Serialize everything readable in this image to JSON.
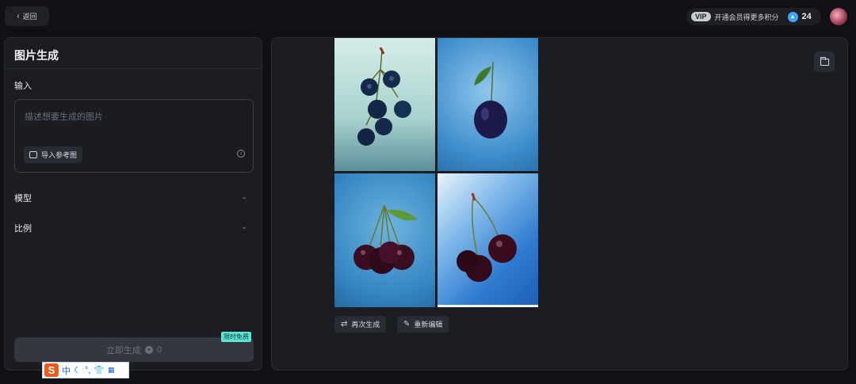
{
  "topbar": {
    "back_label": "返回",
    "vip_badge": "VIP",
    "vip_promo": "开通会员得更多积分",
    "credits": "24"
  },
  "left_panel": {
    "title": "图片生成",
    "input_label": "输入",
    "input_placeholder": "描述想要生成的图片",
    "ref_button": "导入参考图",
    "model_label": "模型",
    "ratio_label": "比例",
    "generate_label": "立即生成",
    "generate_cost": "0",
    "free_badge": "限时免费"
  },
  "ime": {
    "logo": "S",
    "mode": "中",
    "icons": [
      "moon-icon",
      "punctuation-icon",
      "shirt-icon",
      "grid-icon"
    ]
  },
  "right_panel": {
    "images": [
      {
        "subject": "cherry cluster on pale teal background"
      },
      {
        "subject": "single dark cherry with leaf on blue background"
      },
      {
        "subject": "cherry bunch with leaf on blue background"
      },
      {
        "subject": "cherry pair on gradient blue background"
      }
    ],
    "regenerate_label": "再次生成",
    "reedit_label": "重新编辑"
  },
  "colors": {
    "background": "#101114",
    "panel": "#1b1d22",
    "accent_badge": "#5fe3d3",
    "credit_blue": "#3aa7ff"
  }
}
